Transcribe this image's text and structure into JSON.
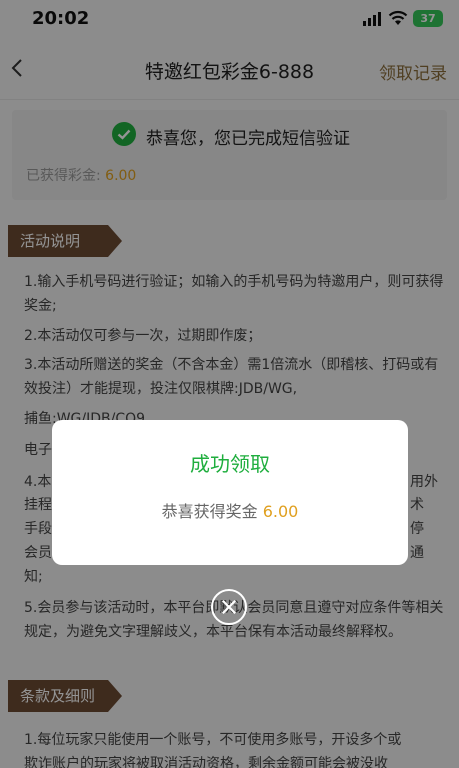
{
  "status": {
    "time": "20:02",
    "battery": "37"
  },
  "nav": {
    "title": "特邀红包彩金6-888",
    "record_link": "领取记录"
  },
  "card": {
    "title": "恭喜您，您已完成短信验证",
    "amount_label": "已获得彩金:",
    "amount_value": "6.00"
  },
  "sections": {
    "activity_title": "活动说明",
    "rules": [
      "1.输入手机号码进行验证；如输入的手机号码为特邀用户，则可获得奖金;",
      "2.本活动仅可参与一次，过期即作废；",
      "3.本活动所赠送的奖金（不含本金）需1倍流水（即稽核、打码或有效投注）才能提现，投注仅限棋牌:JDB/WG,",
      "捕鱼:WG/JDB/CQ9",
      "电子",
      "4.本",
      "5.会员参与该活动时，本平台即默认会员同意且遵守对应条件等相关规定，为避免文字理解歧义，本平台保有本活动最终解释权。"
    ],
    "rule4_fragments": {
      "right1": "用外",
      "left2": "挂程",
      "right2": "术",
      "left3": "手段",
      "right3": "停",
      "left4": "会员",
      "right4": "通",
      "line5": "知;"
    },
    "terms_title": "条款及细则",
    "terms": [
      "1.每位玩家只能使用一个账号，不可使用多账号，开设多个或",
      "欺诈账户的玩家将被取消活动资格，剩余金额可能会被没收"
    ]
  },
  "modal": {
    "title": "成功领取",
    "text": "恭喜获得奖金",
    "value": "6.00"
  }
}
